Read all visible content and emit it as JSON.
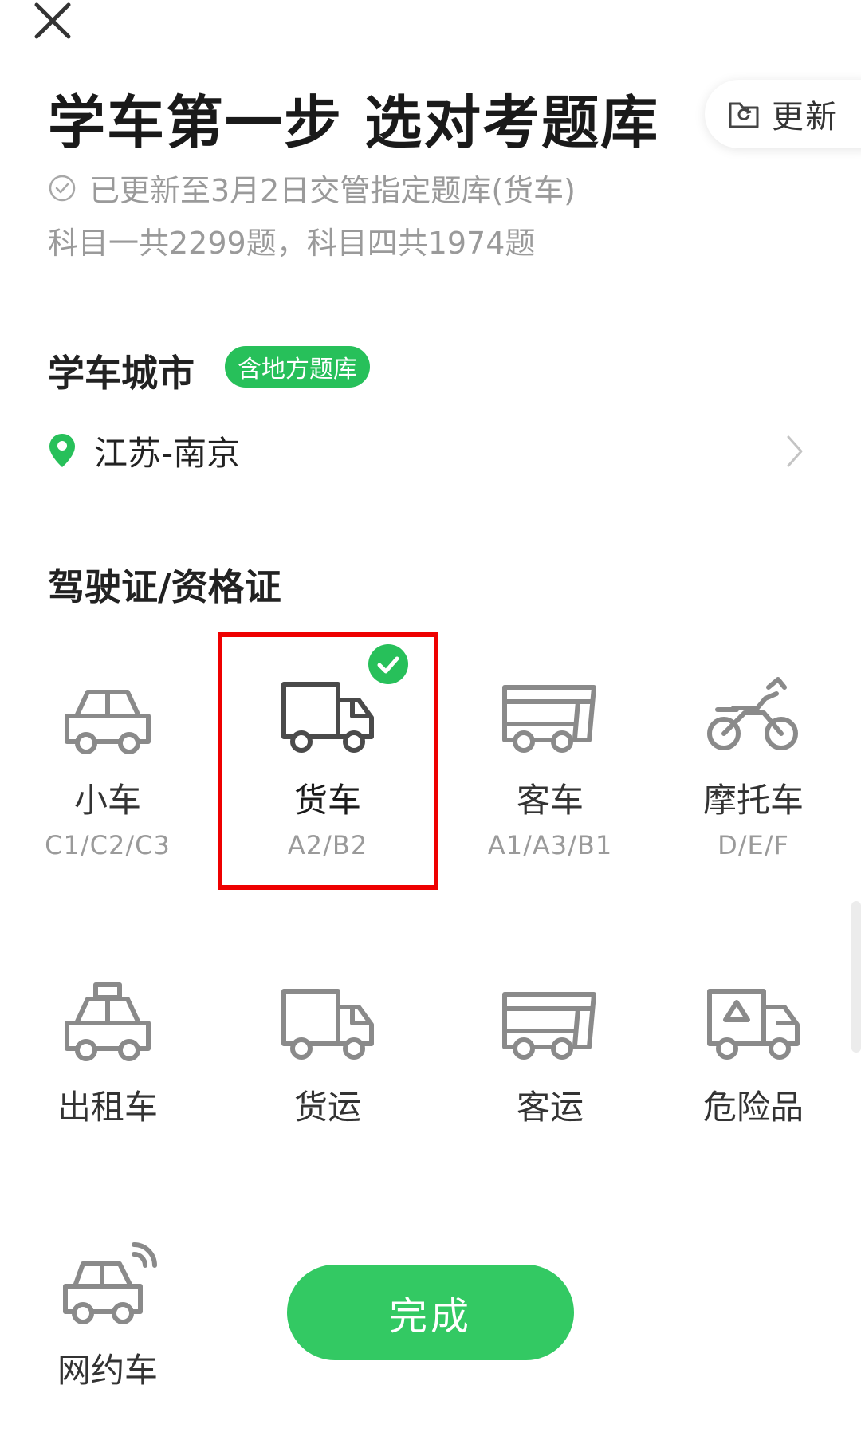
{
  "header": {
    "close_icon": "close-icon",
    "update_button": {
      "icon": "refresh-folder-icon",
      "label": "更新"
    }
  },
  "title": "学车第一步 选对考题库",
  "subtitle": {
    "icon": "check-circle-icon",
    "text": "已更新至3月2日交管指定题库(货车)"
  },
  "question_counts": "科目一共2299题，科目四共1974题",
  "city_section": {
    "title": "学车城市",
    "badge": "含地方题库",
    "location_icon": "location-pin-icon",
    "city": "江苏-南京",
    "chevron_icon": "chevron-right-icon"
  },
  "license_section": {
    "title": "驾驶证/资格证",
    "items": [
      {
        "name": "小车",
        "code": "C1/C2/C3",
        "icon": "car-icon",
        "selected": false
      },
      {
        "name": "货车",
        "code": "A2/B2",
        "icon": "truck-icon",
        "selected": true
      },
      {
        "name": "客车",
        "code": "A1/A3/B1",
        "icon": "bus-icon",
        "selected": false
      },
      {
        "name": "摩托车",
        "code": "D/E/F",
        "icon": "motorcycle-icon",
        "selected": false
      },
      {
        "name": "出租车",
        "icon": "taxi-icon",
        "selected": false
      },
      {
        "name": "货运",
        "icon": "freight-truck-icon",
        "selected": false
      },
      {
        "name": "客运",
        "icon": "passenger-bus-icon",
        "selected": false
      },
      {
        "name": "危险品",
        "icon": "hazmat-truck-icon",
        "selected": false
      },
      {
        "name": "网约车",
        "icon": "ride-hailing-car-icon",
        "selected": false
      }
    ]
  },
  "done_button": {
    "label": "完成"
  },
  "colors": {
    "accent_green": "#27c05a",
    "button_green": "#33c963",
    "highlight_red": "#ee0000",
    "icon_gray": "#8a8a8a"
  }
}
